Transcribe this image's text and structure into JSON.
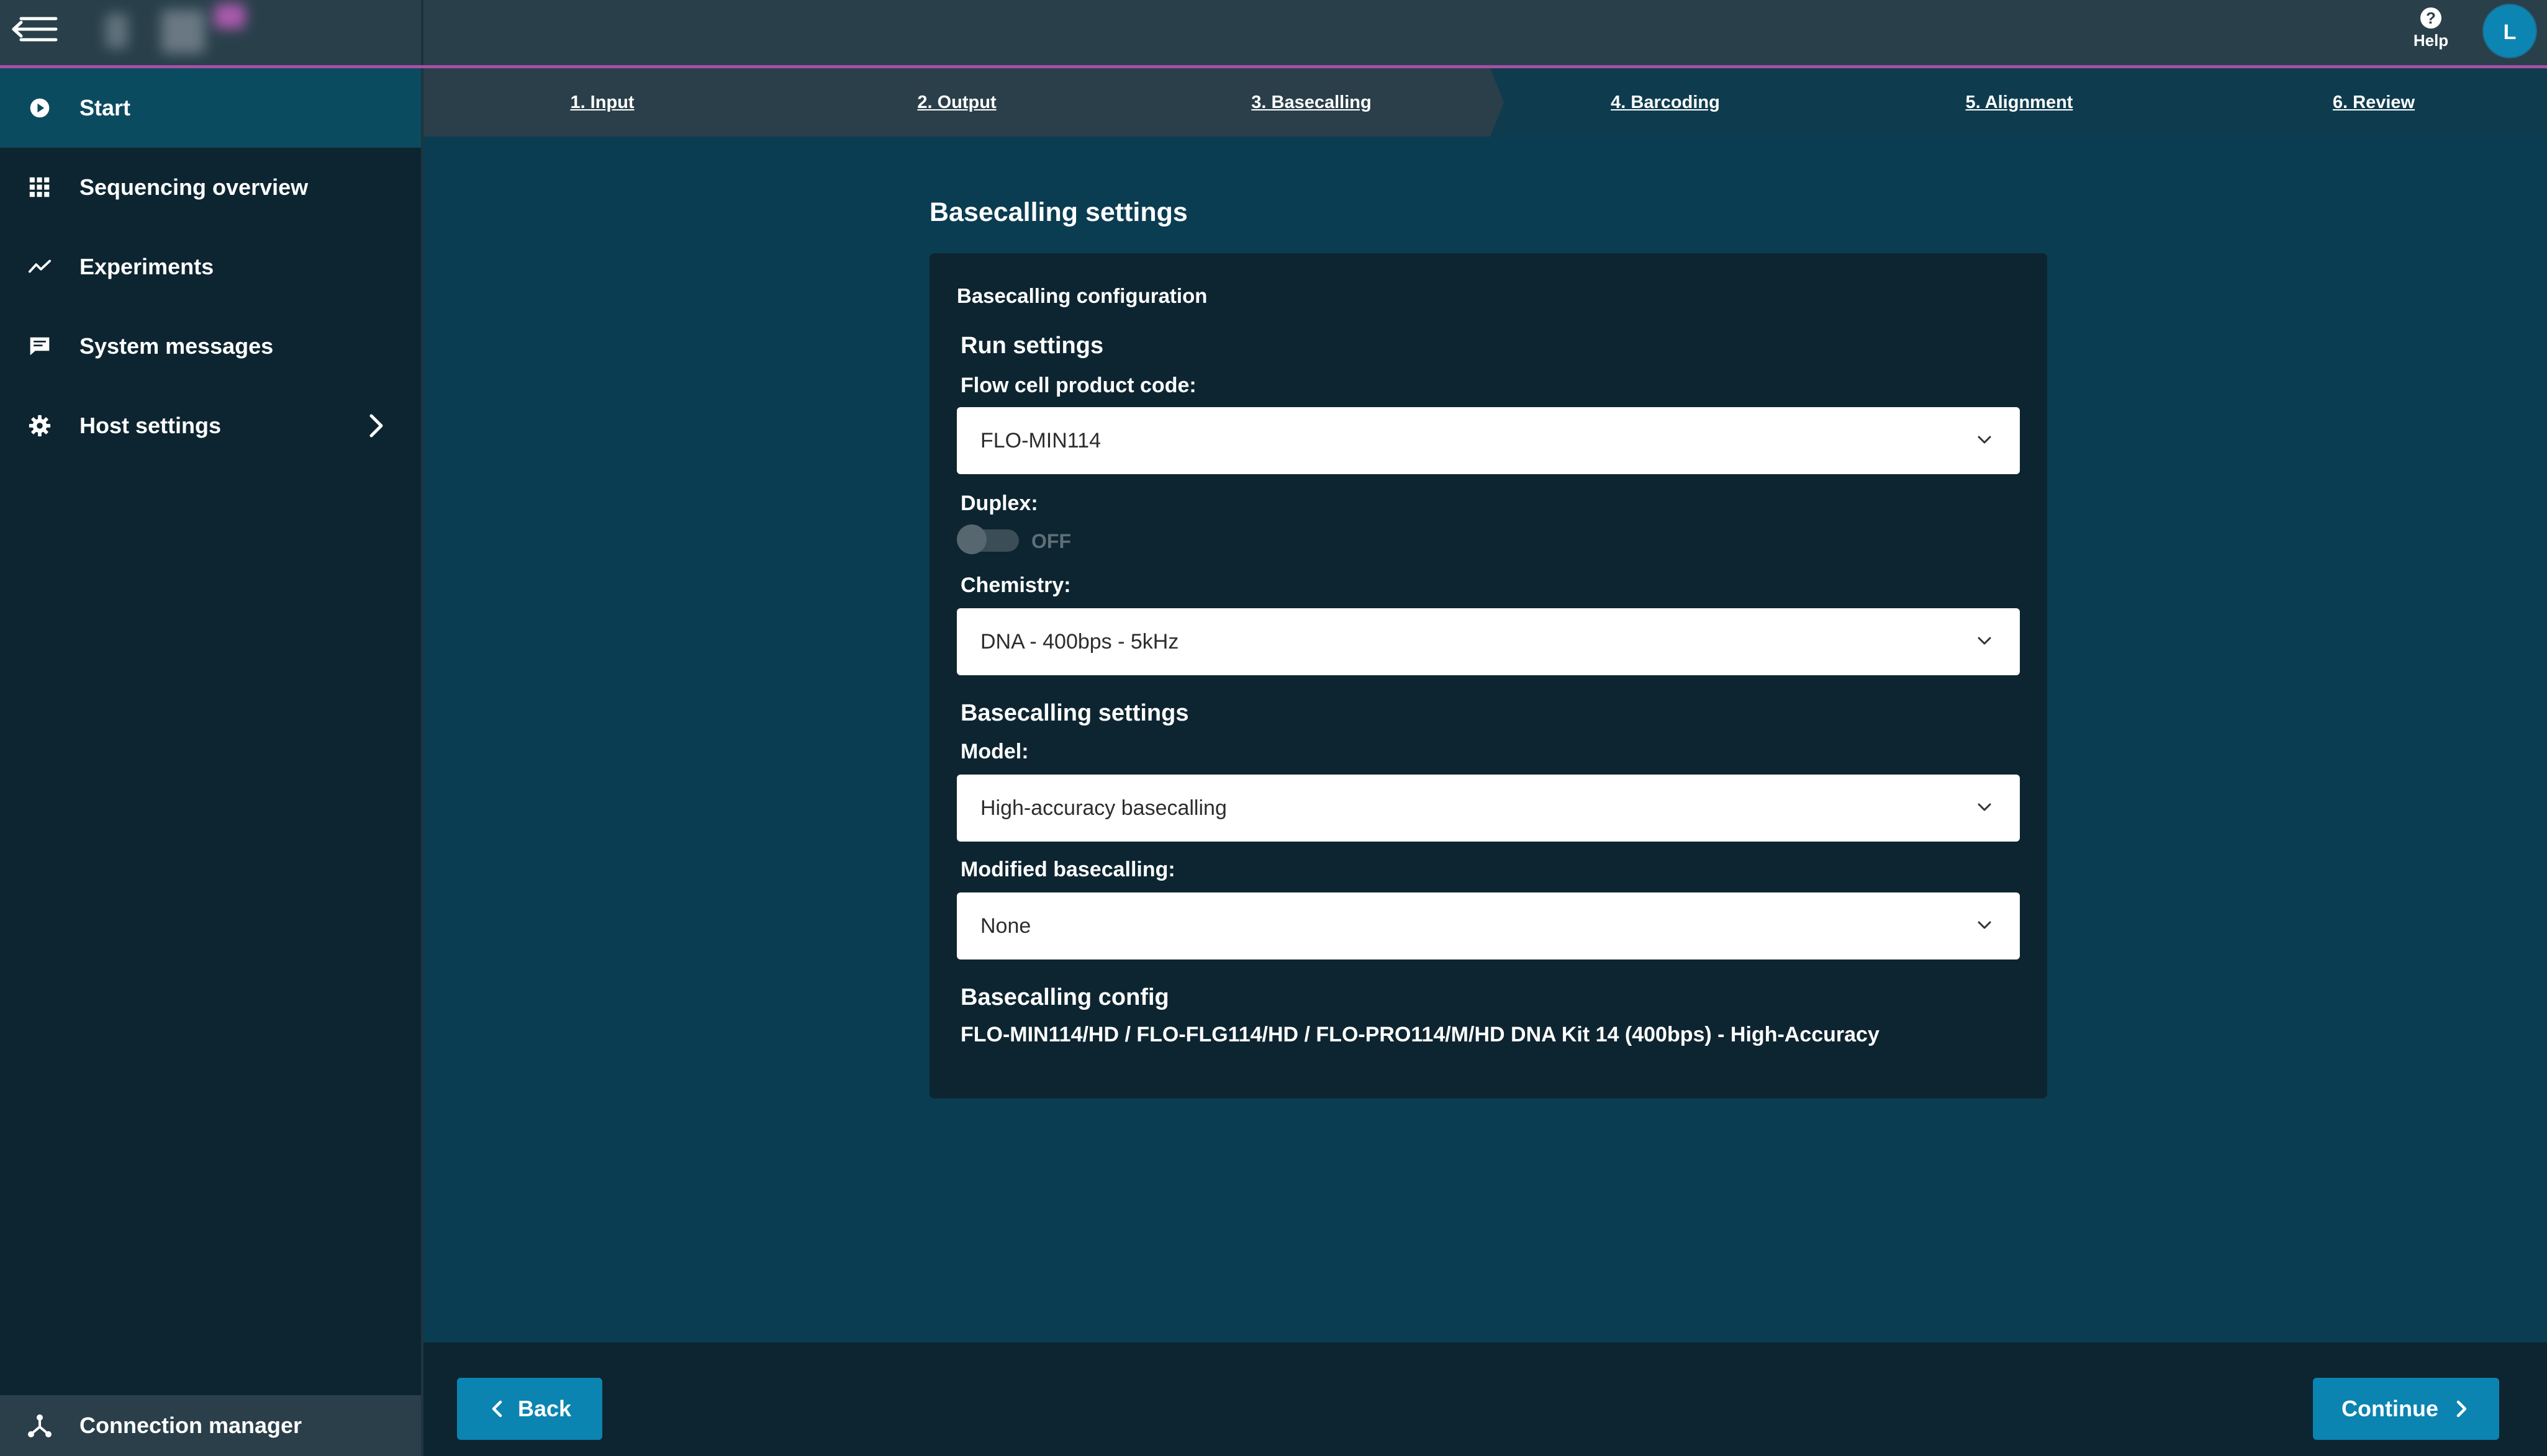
{
  "header": {
    "help_label": "Help",
    "avatar_initial": "L"
  },
  "sidebar": {
    "items": [
      {
        "label": "Start",
        "icon": "play-circle-icon"
      },
      {
        "label": "Sequencing overview",
        "icon": "grid-icon"
      },
      {
        "label": "Experiments",
        "icon": "trend-line-icon"
      },
      {
        "label": "System messages",
        "icon": "message-icon"
      },
      {
        "label": "Host settings",
        "icon": "gear-icon"
      }
    ],
    "connection_manager": "Connection manager"
  },
  "steps": [
    "1. Input",
    "2. Output",
    "3. Basecalling",
    "4. Barcoding",
    "5. Alignment",
    "6. Review"
  ],
  "main": {
    "page_title": "Basecalling settings",
    "card_title": "Basecalling configuration",
    "run_settings": {
      "heading": "Run settings",
      "flow_cell_label": "Flow cell product code:",
      "flow_cell_value": "FLO-MIN114",
      "duplex_label": "Duplex:",
      "duplex_state": "OFF",
      "chemistry_label": "Chemistry:",
      "chemistry_value": "DNA - 400bps - 5kHz"
    },
    "basecalling_settings": {
      "heading": "Basecalling settings",
      "model_label": "Model:",
      "model_value": "High-accuracy basecalling",
      "modified_label": "Modified basecalling:",
      "modified_value": "None"
    },
    "config": {
      "heading": "Basecalling config",
      "value": "FLO-MIN114/HD / FLO-FLG114/HD / FLO-PRO114/M/HD DNA Kit 14 (400bps) - High-Accuracy"
    }
  },
  "footer": {
    "back_label": "Back",
    "continue_label": "Continue"
  },
  "colors": {
    "background": "#0b3d52",
    "sidebar": "#0d2530",
    "topbar": "#29404b",
    "accent_line": "#a64fa5",
    "primary_button": "#0b84b1"
  }
}
